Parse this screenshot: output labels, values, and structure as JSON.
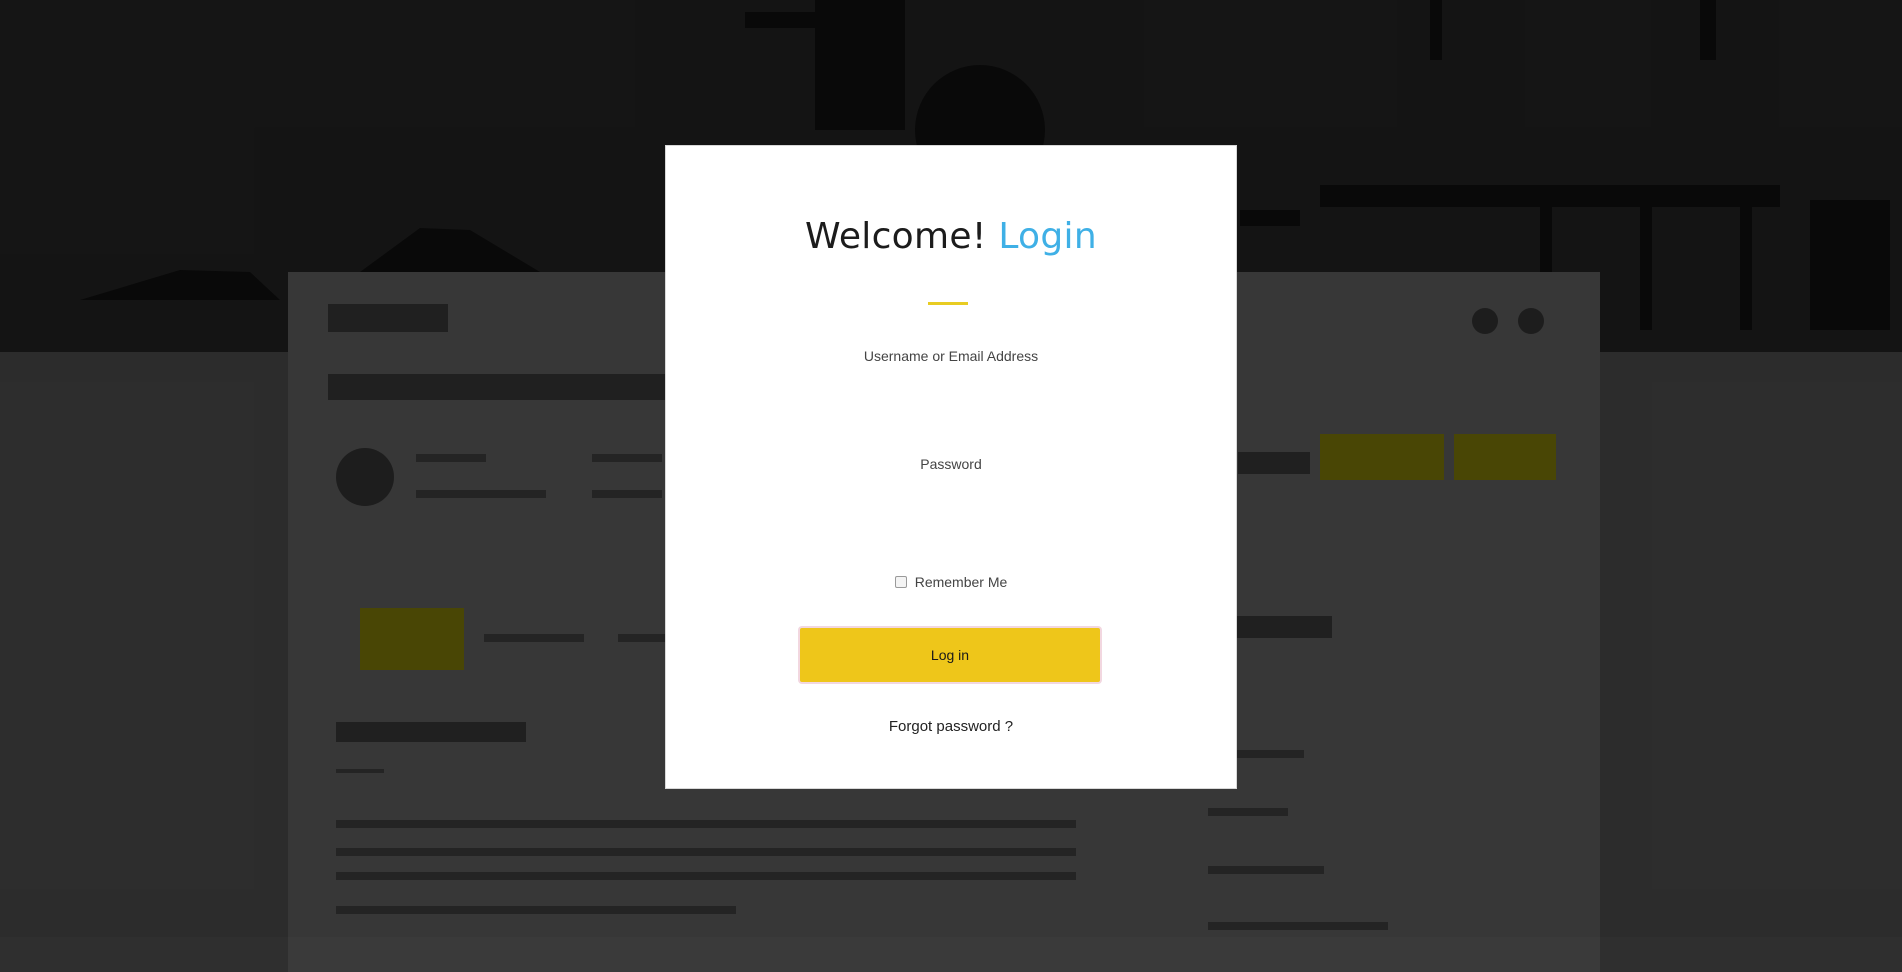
{
  "modal": {
    "title_main": "Welcome!",
    "title_accent": "Login",
    "username_label": "Username or Email Address",
    "password_label": "Password",
    "remember_label": "Remember Me",
    "login_button": "Log in",
    "forgot_link": "Forgot password ?"
  },
  "colors": {
    "accent_blue": "#3fb0e6",
    "accent_yellow": "#eec61a"
  }
}
